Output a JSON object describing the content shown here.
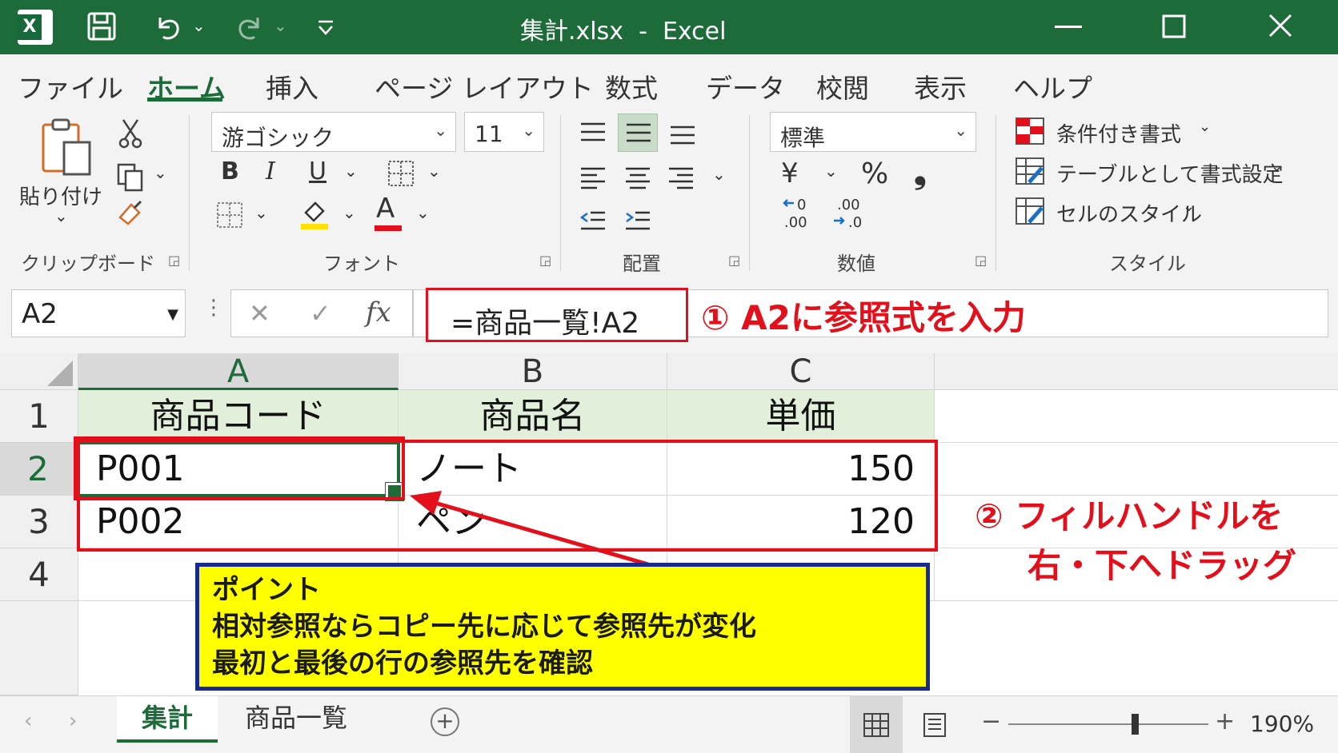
{
  "title_bar": {
    "title": "集計.xlsx  -  Excel",
    "icons": [
      "excel-logo-icon",
      "save-icon",
      "undo-icon",
      "redo-icon",
      "customize-qat-icon",
      "minimize-icon",
      "maximize-icon",
      "close-icon"
    ],
    "excel_letter": "X"
  },
  "menu": {
    "items": [
      "ファイル",
      "ホーム",
      "挿入",
      "ページ レイアウト",
      "数式",
      "データ",
      "校閲",
      "表示",
      "ヘルプ"
    ],
    "active": "ホーム"
  },
  "ribbon": {
    "clipboard": {
      "paste_label": "貼り付け",
      "group_label": "クリップボード"
    },
    "font": {
      "font_name": "游ゴシック",
      "font_size": "11",
      "bold": "B",
      "italic": "I",
      "underline": "U",
      "font_color_glyph": "A",
      "group_label": "フォント"
    },
    "alignment": {
      "group_label": "配置"
    },
    "number": {
      "format": "標準",
      "currency": "¥",
      "percent": "%",
      "comma": "❟",
      "group_label": "数値"
    },
    "styles": {
      "items": [
        "条件付き書式",
        "テーブルとして書式設定",
        "セルのスタイル"
      ],
      "group_label": "スタイル"
    }
  },
  "formula_bar": {
    "name_box": "A2",
    "cancel": "✕",
    "enter": "✓",
    "fx": "fx",
    "formula": "=商品一覧!A2"
  },
  "grid": {
    "columns": [
      "A",
      "B",
      "C"
    ],
    "rows": [
      "1",
      "2",
      "3",
      "4"
    ],
    "cells": [
      [
        "商品コード",
        "商品名",
        "単価"
      ],
      [
        "P001",
        "ノート",
        "150"
      ],
      [
        "P002",
        "ペン",
        "120"
      ]
    ],
    "selected_cell": "A2"
  },
  "annotations": {
    "step1": "① A2に参照式を入力",
    "step2_line1": "② フィルハンドルを",
    "step2_line2": "右・下へドラッグ",
    "point_title": "ポイント",
    "point_line1": "相対参照ならコピー先に応じて参照先が変化",
    "point_line2": "最初と最後の行の参照先を確認"
  },
  "status_bar": {
    "sheets": [
      "集計",
      "商品一覧"
    ],
    "active_sheet": "集計",
    "add_sheet": "+",
    "zoom_minus": "−",
    "zoom_plus": "+",
    "zoom": "190%"
  },
  "colors": {
    "excel_green": "#1e6b3a",
    "header_fill": "#e2efda",
    "annotation_red": "#e3101b",
    "note_yellow": "#ffff00",
    "note_border": "#1a2a8a"
  }
}
